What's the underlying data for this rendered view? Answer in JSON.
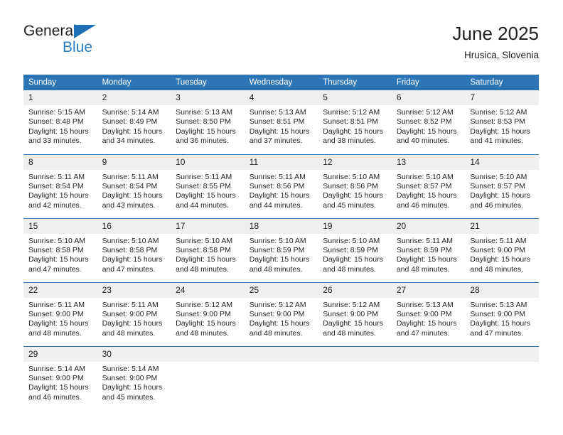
{
  "brand": {
    "name_top": "General",
    "name_bottom": "Blue",
    "triangle_icon": "brand-triangle-icon",
    "accent_dark": "#1f6fb5",
    "accent_light": "#2a7fc4"
  },
  "header": {
    "title": "June 2025",
    "subtitle": "Hrusica, Slovenia"
  },
  "theme": {
    "header_blue": "#2e75b6",
    "daynum_band": "#efefef",
    "text": "#231f20"
  },
  "calendar": {
    "weekday_headers": [
      "Sunday",
      "Monday",
      "Tuesday",
      "Wednesday",
      "Thursday",
      "Friday",
      "Saturday"
    ],
    "weeks": [
      [
        {
          "day": "1",
          "sunrise": "Sunrise: 5:15 AM",
          "sunset": "Sunset: 8:48 PM",
          "daylight": "Daylight: 15 hours and 33 minutes."
        },
        {
          "day": "2",
          "sunrise": "Sunrise: 5:14 AM",
          "sunset": "Sunset: 8:49 PM",
          "daylight": "Daylight: 15 hours and 34 minutes."
        },
        {
          "day": "3",
          "sunrise": "Sunrise: 5:13 AM",
          "sunset": "Sunset: 8:50 PM",
          "daylight": "Daylight: 15 hours and 36 minutes."
        },
        {
          "day": "4",
          "sunrise": "Sunrise: 5:13 AM",
          "sunset": "Sunset: 8:51 PM",
          "daylight": "Daylight: 15 hours and 37 minutes."
        },
        {
          "day": "5",
          "sunrise": "Sunrise: 5:12 AM",
          "sunset": "Sunset: 8:51 PM",
          "daylight": "Daylight: 15 hours and 38 minutes."
        },
        {
          "day": "6",
          "sunrise": "Sunrise: 5:12 AM",
          "sunset": "Sunset: 8:52 PM",
          "daylight": "Daylight: 15 hours and 40 minutes."
        },
        {
          "day": "7",
          "sunrise": "Sunrise: 5:12 AM",
          "sunset": "Sunset: 8:53 PM",
          "daylight": "Daylight: 15 hours and 41 minutes."
        }
      ],
      [
        {
          "day": "8",
          "sunrise": "Sunrise: 5:11 AM",
          "sunset": "Sunset: 8:54 PM",
          "daylight": "Daylight: 15 hours and 42 minutes."
        },
        {
          "day": "9",
          "sunrise": "Sunrise: 5:11 AM",
          "sunset": "Sunset: 8:54 PM",
          "daylight": "Daylight: 15 hours and 43 minutes."
        },
        {
          "day": "10",
          "sunrise": "Sunrise: 5:11 AM",
          "sunset": "Sunset: 8:55 PM",
          "daylight": "Daylight: 15 hours and 44 minutes."
        },
        {
          "day": "11",
          "sunrise": "Sunrise: 5:11 AM",
          "sunset": "Sunset: 8:56 PM",
          "daylight": "Daylight: 15 hours and 44 minutes."
        },
        {
          "day": "12",
          "sunrise": "Sunrise: 5:10 AM",
          "sunset": "Sunset: 8:56 PM",
          "daylight": "Daylight: 15 hours and 45 minutes."
        },
        {
          "day": "13",
          "sunrise": "Sunrise: 5:10 AM",
          "sunset": "Sunset: 8:57 PM",
          "daylight": "Daylight: 15 hours and 46 minutes."
        },
        {
          "day": "14",
          "sunrise": "Sunrise: 5:10 AM",
          "sunset": "Sunset: 8:57 PM",
          "daylight": "Daylight: 15 hours and 46 minutes."
        }
      ],
      [
        {
          "day": "15",
          "sunrise": "Sunrise: 5:10 AM",
          "sunset": "Sunset: 8:58 PM",
          "daylight": "Daylight: 15 hours and 47 minutes."
        },
        {
          "day": "16",
          "sunrise": "Sunrise: 5:10 AM",
          "sunset": "Sunset: 8:58 PM",
          "daylight": "Daylight: 15 hours and 47 minutes."
        },
        {
          "day": "17",
          "sunrise": "Sunrise: 5:10 AM",
          "sunset": "Sunset: 8:58 PM",
          "daylight": "Daylight: 15 hours and 48 minutes."
        },
        {
          "day": "18",
          "sunrise": "Sunrise: 5:10 AM",
          "sunset": "Sunset: 8:59 PM",
          "daylight": "Daylight: 15 hours and 48 minutes."
        },
        {
          "day": "19",
          "sunrise": "Sunrise: 5:10 AM",
          "sunset": "Sunset: 8:59 PM",
          "daylight": "Daylight: 15 hours and 48 minutes."
        },
        {
          "day": "20",
          "sunrise": "Sunrise: 5:11 AM",
          "sunset": "Sunset: 8:59 PM",
          "daylight": "Daylight: 15 hours and 48 minutes."
        },
        {
          "day": "21",
          "sunrise": "Sunrise: 5:11 AM",
          "sunset": "Sunset: 9:00 PM",
          "daylight": "Daylight: 15 hours and 48 minutes."
        }
      ],
      [
        {
          "day": "22",
          "sunrise": "Sunrise: 5:11 AM",
          "sunset": "Sunset: 9:00 PM",
          "daylight": "Daylight: 15 hours and 48 minutes."
        },
        {
          "day": "23",
          "sunrise": "Sunrise: 5:11 AM",
          "sunset": "Sunset: 9:00 PM",
          "daylight": "Daylight: 15 hours and 48 minutes."
        },
        {
          "day": "24",
          "sunrise": "Sunrise: 5:12 AM",
          "sunset": "Sunset: 9:00 PM",
          "daylight": "Daylight: 15 hours and 48 minutes."
        },
        {
          "day": "25",
          "sunrise": "Sunrise: 5:12 AM",
          "sunset": "Sunset: 9:00 PM",
          "daylight": "Daylight: 15 hours and 48 minutes."
        },
        {
          "day": "26",
          "sunrise": "Sunrise: 5:12 AM",
          "sunset": "Sunset: 9:00 PM",
          "daylight": "Daylight: 15 hours and 48 minutes."
        },
        {
          "day": "27",
          "sunrise": "Sunrise: 5:13 AM",
          "sunset": "Sunset: 9:00 PM",
          "daylight": "Daylight: 15 hours and 47 minutes."
        },
        {
          "day": "28",
          "sunrise": "Sunrise: 5:13 AM",
          "sunset": "Sunset: 9:00 PM",
          "daylight": "Daylight: 15 hours and 47 minutes."
        }
      ],
      [
        {
          "day": "29",
          "sunrise": "Sunrise: 5:14 AM",
          "sunset": "Sunset: 9:00 PM",
          "daylight": "Daylight: 15 hours and 46 minutes."
        },
        {
          "day": "30",
          "sunrise": "Sunrise: 5:14 AM",
          "sunset": "Sunset: 9:00 PM",
          "daylight": "Daylight: 15 hours and 45 minutes."
        },
        {
          "day": "",
          "sunrise": "",
          "sunset": "",
          "daylight": ""
        },
        {
          "day": "",
          "sunrise": "",
          "sunset": "",
          "daylight": ""
        },
        {
          "day": "",
          "sunrise": "",
          "sunset": "",
          "daylight": ""
        },
        {
          "day": "",
          "sunrise": "",
          "sunset": "",
          "daylight": ""
        },
        {
          "day": "",
          "sunrise": "",
          "sunset": "",
          "daylight": ""
        }
      ]
    ]
  }
}
